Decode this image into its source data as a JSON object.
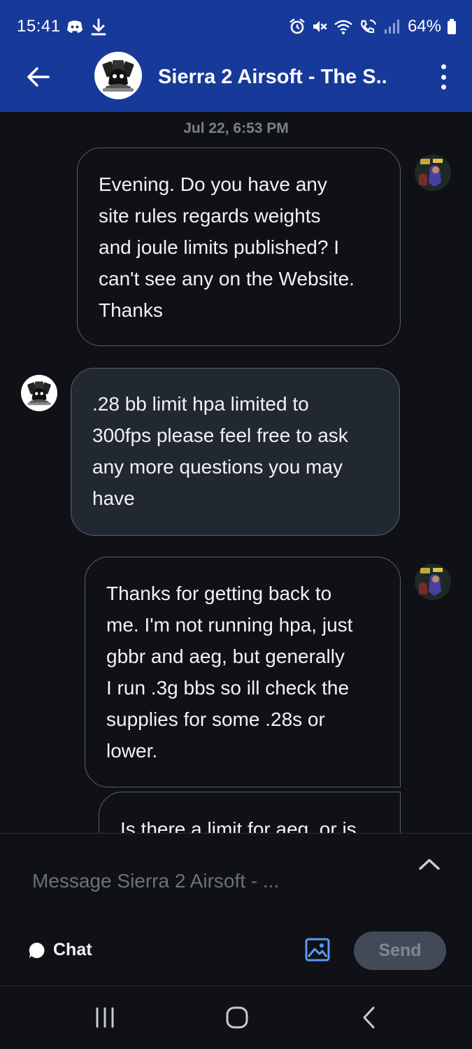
{
  "status_bar": {
    "time": "15:41",
    "battery": "64%"
  },
  "app_bar": {
    "title": "Sierra 2 Airsoft - The S.."
  },
  "conversation": {
    "date_separator": "Jul 22, 6:53 PM",
    "messages": [
      {
        "sender": "user",
        "lines": [
          "Evening. Do you have any",
          "site rules regards weights",
          "and joule limits published? I",
          "can't see any on the Website.",
          "Thanks"
        ]
      },
      {
        "sender": "business",
        "lines": [
          ".28 bb limit hpa limited to",
          "300fps please feel free to ask",
          "any more questions you may",
          "have"
        ]
      },
      {
        "sender": "user",
        "lines": [
          "Thanks for getting back to",
          "me. I'm not running hpa, just",
          "gbbr and aeg, but generally",
          "I run .3g bbs so ill check the",
          "supplies for some .28s or",
          "lower."
        ]
      },
      {
        "sender": "user",
        "lines": [
          "Is there a limit for aeg, or is"
        ]
      }
    ]
  },
  "composer": {
    "placeholder": "Message Sierra 2 Airsoft - ...",
    "mode_label": "Chat",
    "send_label": "Send"
  },
  "colors": {
    "header_bg": "#17399a",
    "page_bg": "#0f1116",
    "incoming_bubble_bg": "#222831",
    "send_button_bg": "#434a57",
    "image_icon": "#5b9af5"
  },
  "icons": {
    "status_left": [
      "discord-icon",
      "download-icon"
    ],
    "status_right": [
      "alarm-icon",
      "mute-icon",
      "wifi-icon",
      "wifi-calling-icon",
      "signal-icon",
      "battery-icon"
    ],
    "app_bar": [
      "back-arrow-icon",
      "more-vert-icon"
    ],
    "composer": [
      "chevron-up-icon",
      "chat-bubble-icon",
      "image-icon"
    ],
    "navbar": [
      "recents-icon",
      "home-icon",
      "nav-back-icon"
    ]
  }
}
